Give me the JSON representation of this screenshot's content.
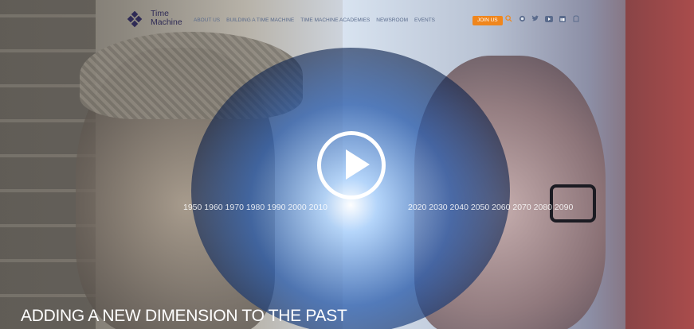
{
  "logo": {
    "line1": "Time",
    "line2": "Machine"
  },
  "nav": [
    {
      "label": "ABOUT US"
    },
    {
      "label": "BUILDING A TIME MACHINE"
    },
    {
      "label": "TIME MACHINE ACADEMIES"
    },
    {
      "label": "NEWSROOM"
    },
    {
      "label": "EVENTS"
    }
  ],
  "join_label": "JOIN US",
  "icons": [
    "search-icon",
    "github-icon",
    "twitter-icon",
    "youtube-icon",
    "linkedin-icon",
    "facebook-icon"
  ],
  "timeline": {
    "left": "1950 1960 1970 1980 1990 2000 2010",
    "right": "2020 2030 2040 2050 2060 2070 2080 2090"
  },
  "headline": "ADDING A NEW DIMENSION TO THE PAST",
  "colors": {
    "join": "#f0861c",
    "logo": "#2e2a55",
    "nav": "#5a6b8c"
  }
}
